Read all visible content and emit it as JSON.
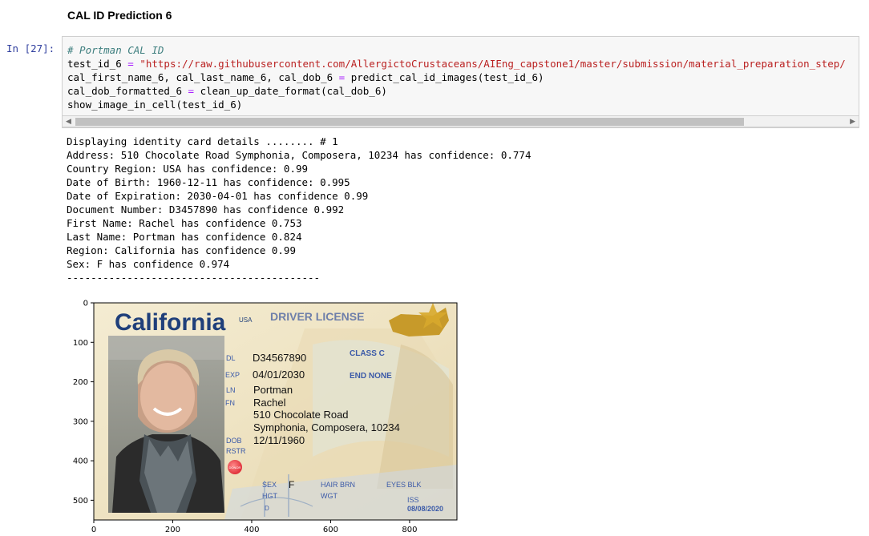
{
  "cell": {
    "heading": "CAL ID Prediction 6",
    "prompt": "In [27]:",
    "code": {
      "comment": "# Portman CAL ID",
      "line2_var": "test_id_6 ",
      "line2_eq": "=",
      "line2_str": " \"https://raw.githubusercontent.com/AllergictoCrustaceans/AIEng_capstone1/master/submission/material_preparation_step/",
      "line3_a": "cal_first_name_6, cal_last_name_6, cal_dob_6 ",
      "line3_eq": "=",
      "line3_b": " predict_cal_id_images(test_id_6)",
      "line4_a": "cal_dob_formatted_6 ",
      "line4_eq": "=",
      "line4_b": " clean_up_date_format(cal_dob_6)",
      "line5": "show_image_in_cell(test_id_6)"
    }
  },
  "output": {
    "lines": [
      "Displaying identity card details ........ # 1",
      "Address: 510 Chocolate Road Symphonia, Composera, 10234 has confidence: 0.774",
      "Country Region: USA has confidence: 0.99",
      "Date of Birth: 1960-12-11 has confidence: 0.995",
      "Date of Expiration: 2030-04-01 has confidence 0.99",
      "Document Number: D3457890 has confidence 0.992",
      "First Name: Rachel has confidence 0.753",
      "Last Name: Portman has confidence 0.824",
      "Region: California has confidence 0.99",
      "Sex: F has confidence 0.974",
      "------------------------------------------"
    ]
  },
  "plot": {
    "y_ticks": [
      "0",
      "100",
      "200",
      "300",
      "400",
      "500"
    ],
    "x_ticks": [
      "0",
      "200",
      "400",
      "600",
      "800"
    ]
  },
  "card": {
    "state": "California",
    "usa": "USA",
    "type": "DRIVER LICENSE",
    "dl_label": "DL",
    "dl": "D34567890",
    "class": "CLASS C",
    "exp_label": "EXP",
    "exp": "04/01/2030",
    "end": "END NONE",
    "ln_label": "LN",
    "ln": "Portman",
    "fn_label": "FN",
    "fn": "Rachel",
    "addr1": "510 Chocolate Road",
    "addr2": "Symphonia, Composera, 10234",
    "dob_label": "DOB",
    "dob": "12/11/1960",
    "rstr": "RSTR",
    "donor": "DONOR",
    "sex_label": "SEX",
    "sex": "F",
    "hair": "HAIR BRN",
    "eyes": "EYES BLK",
    "hgt": "HGT",
    "wgt": "WGT",
    "iss": "ISS",
    "iss_date": "08/08/2020",
    "d": "D"
  }
}
